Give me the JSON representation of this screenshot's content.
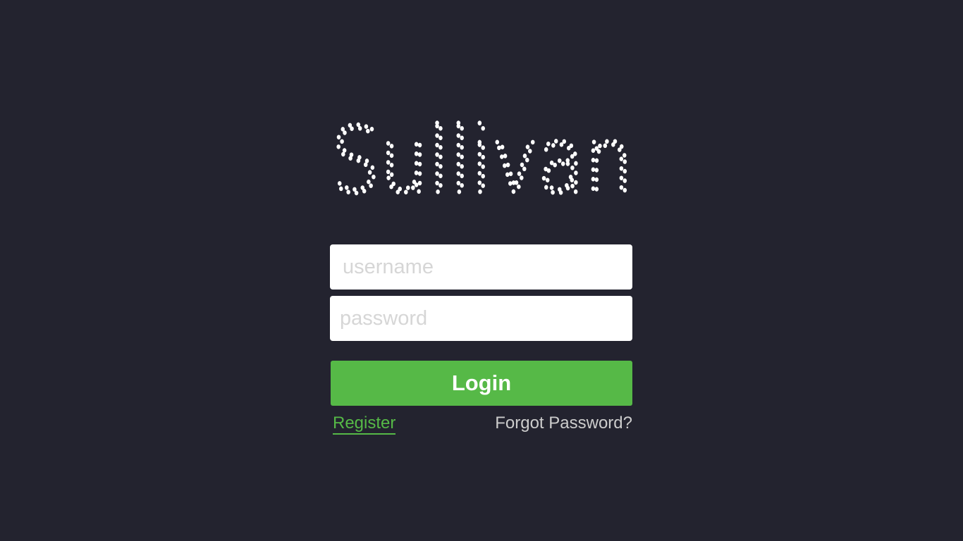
{
  "app": {
    "logo_text": "Sullivan"
  },
  "login_form": {
    "username_placeholder": "username",
    "password_placeholder": "password",
    "login_label": "Login",
    "register_label": "Register",
    "forgot_password_label": "Forgot Password?"
  },
  "colors": {
    "background": "#23232f",
    "accent": "#56b947",
    "field_background": "#ffffff",
    "placeholder": "#d6d6d6",
    "muted_link": "#cccccc"
  }
}
